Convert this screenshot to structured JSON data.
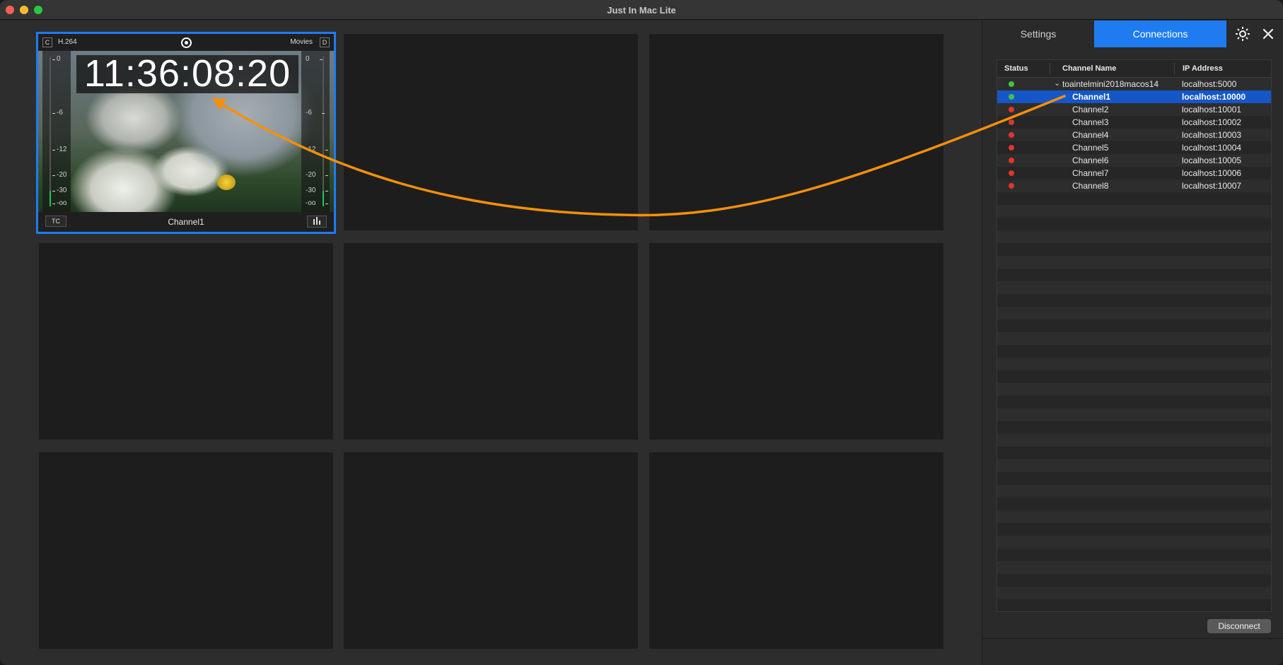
{
  "window": {
    "title": "Just In Mac Lite"
  },
  "preview": {
    "left_badge": "C",
    "codec": "H.264",
    "destination": "Movies",
    "right_badge": "D",
    "timecode": "11:36:08:20",
    "meter_left_ticks": [
      "0",
      "-6",
      "-12",
      "-20",
      "-30",
      "-oo"
    ],
    "meter_right_ticks": [
      "0",
      "-6",
      "-12",
      "-20",
      "-30",
      "-oo"
    ],
    "tc_button": "TC",
    "channel_name": "Channel1"
  },
  "sidebar": {
    "tabs": [
      {
        "label": "Settings",
        "active": false
      },
      {
        "label": "Connections",
        "active": true
      }
    ],
    "table": {
      "columns": [
        "Status",
        "Channel Name",
        "IP Address"
      ],
      "rows": [
        {
          "status": "green",
          "name": "toaintelmini2018macos14",
          "ip": "localhost:5000",
          "group": true,
          "selected": false
        },
        {
          "status": "green",
          "name": "Channel1",
          "ip": "localhost:10000",
          "group": false,
          "selected": true
        },
        {
          "status": "red",
          "name": "Channel2",
          "ip": "localhost:10001",
          "group": false,
          "selected": false
        },
        {
          "status": "red",
          "name": "Channel3",
          "ip": "localhost:10002",
          "group": false,
          "selected": false
        },
        {
          "status": "red",
          "name": "Channel4",
          "ip": "localhost:10003",
          "group": false,
          "selected": false
        },
        {
          "status": "red",
          "name": "Channel5",
          "ip": "localhost:10004",
          "group": false,
          "selected": false
        },
        {
          "status": "red",
          "name": "Channel6",
          "ip": "localhost:10005",
          "group": false,
          "selected": false
        },
        {
          "status": "red",
          "name": "Channel7",
          "ip": "localhost:10006",
          "group": false,
          "selected": false
        },
        {
          "status": "red",
          "name": "Channel8",
          "ip": "localhost:10007",
          "group": false,
          "selected": false
        }
      ]
    },
    "disconnect_label": "Disconnect"
  },
  "colors": {
    "accent": "#1e7cf0",
    "status_green": "#3fc34a",
    "status_red": "#e0362c",
    "annotation_arrow": "#f5900b"
  },
  "icons": [
    "record-icon",
    "level-meter-icon",
    "gear-icon",
    "close-icon",
    "chevron-down-icon"
  ]
}
